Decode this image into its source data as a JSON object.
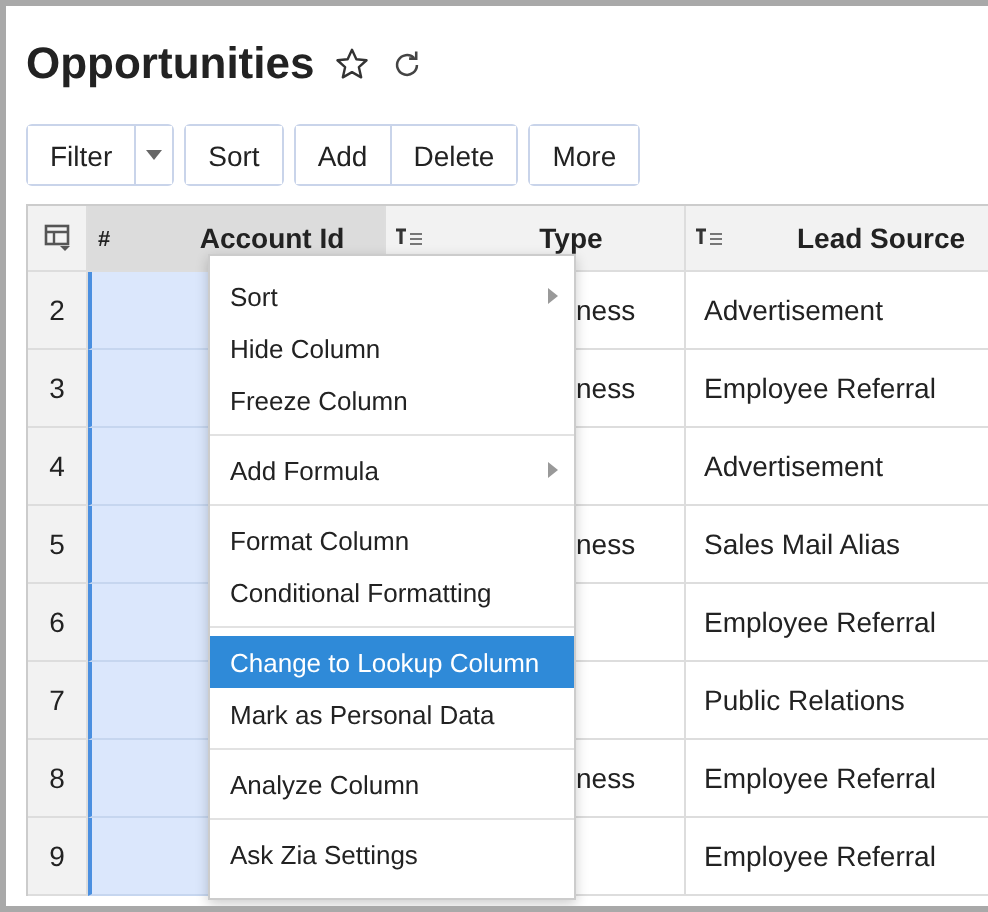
{
  "title": "Opportunities",
  "toolbar": [
    [
      {
        "label": "Filter",
        "kind": "split"
      }
    ],
    [
      {
        "label": "Sort",
        "kind": "plain"
      }
    ],
    [
      {
        "label": "Add",
        "kind": "plain"
      },
      {
        "label": "Delete",
        "kind": "plain"
      }
    ],
    [
      {
        "label": "More",
        "kind": "plain"
      }
    ]
  ],
  "table": {
    "columns": [
      {
        "label": "Account Id",
        "kind": "number",
        "symbol": "#",
        "selected": true
      },
      {
        "label": "Type",
        "kind": "text",
        "selected": false
      },
      {
        "label": "Lead Source",
        "kind": "text",
        "selected": false
      }
    ],
    "rows": [
      {
        "number": "2",
        "type": "ness",
        "lead_source": "Advertisement"
      },
      {
        "number": "3",
        "type": "ness",
        "lead_source": "Employee Referral"
      },
      {
        "number": "4",
        "lead_source": "Advertisement"
      },
      {
        "number": "5",
        "type": "ness",
        "lead_source": "Sales Mail Alias"
      },
      {
        "number": "6",
        "lead_source": "Employee Referral"
      },
      {
        "number": "7",
        "lead_source": "Public Relations"
      },
      {
        "number": "8",
        "type": "ness",
        "lead_source": "Employee Referral"
      },
      {
        "number": "9",
        "lead_source": "Employee Referral"
      }
    ]
  },
  "context_menu": {
    "sections": [
      [
        {
          "label": "Sort",
          "submenu": true,
          "selected": false
        },
        {
          "label": "Hide Column",
          "submenu": false,
          "selected": false
        },
        {
          "label": "Freeze Column",
          "submenu": false,
          "selected": false
        }
      ],
      [
        {
          "label": "Add Formula",
          "submenu": true,
          "selected": false
        }
      ],
      [
        {
          "label": "Format Column",
          "submenu": false,
          "selected": false
        },
        {
          "label": "Conditional Formatting",
          "submenu": false,
          "selected": false
        }
      ],
      [
        {
          "label": "Change to Lookup Column",
          "submenu": false,
          "selected": true
        },
        {
          "label": "Mark as Personal Data",
          "submenu": false,
          "selected": false
        }
      ],
      [
        {
          "label": "Analyze Column",
          "submenu": false,
          "selected": false
        }
      ],
      [
        {
          "label": "Ask Zia Settings",
          "submenu": false,
          "selected": false
        }
      ]
    ]
  }
}
